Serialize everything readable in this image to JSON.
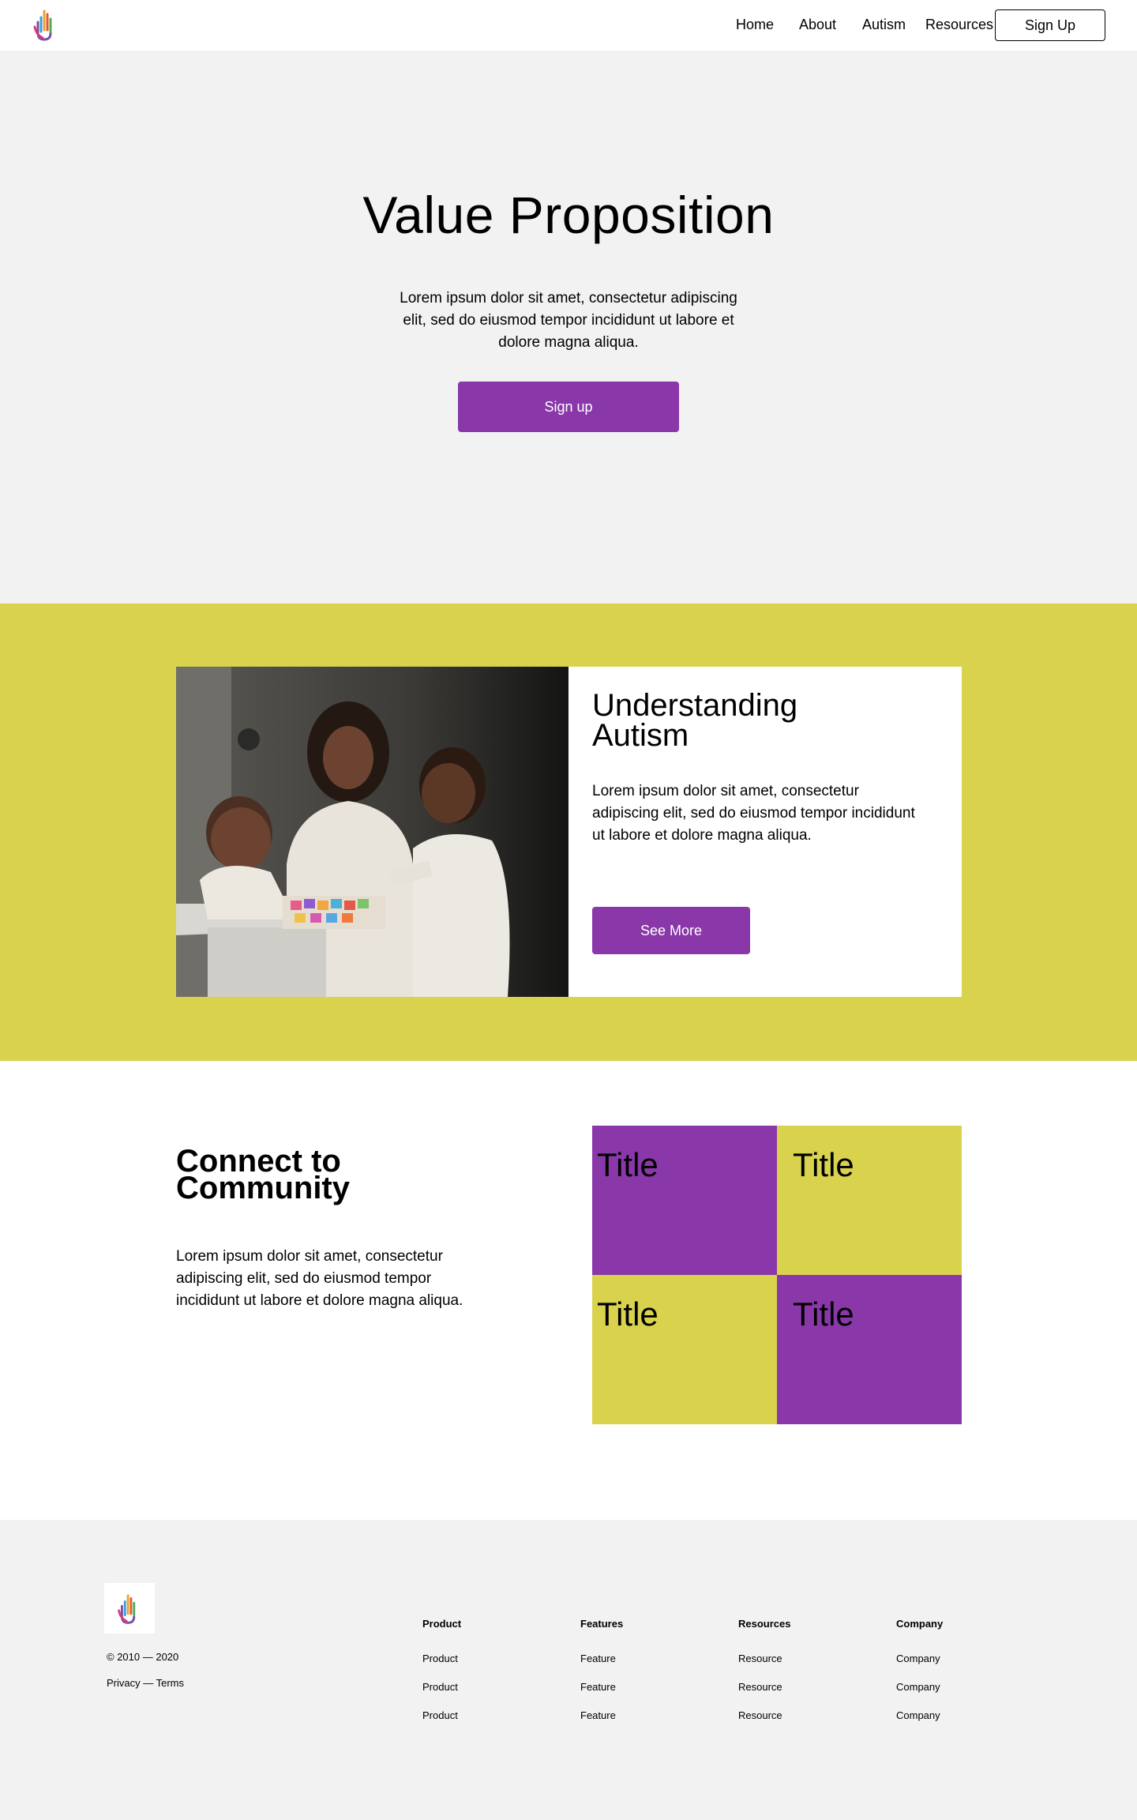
{
  "nav": {
    "links": [
      "Home",
      "About",
      "Autism",
      "Resources"
    ],
    "signup_label": "Sign Up"
  },
  "hero": {
    "title": "Value Proposition",
    "text": "Lorem ipsum dolor sit amet, consectetur adipiscing elit, sed do eiusmod tempor incididunt ut labore et dolore magna aliqua.",
    "button_label": "Sign up"
  },
  "understanding": {
    "title": "Understanding Autism",
    "text": "Lorem ipsum dolor sit amet, consectetur adipiscing elit, sed do eiusmod tempor incididunt ut labore et dolore magna aliqua.",
    "button_label": "See More"
  },
  "community": {
    "title": "Connect to Community",
    "text": "Lorem ipsum dolor sit amet, consectetur adipiscing elit, sed do eiusmod tempor incididunt ut labore et dolore magna aliqua.",
    "tiles": [
      "Title",
      "Title",
      "Title",
      "Title"
    ]
  },
  "footer": {
    "copyright": "© 2010 — 2020",
    "legal": "Privacy — Terms",
    "columns": [
      {
        "heading": "Product",
        "items": [
          "Product",
          "Product",
          "Product"
        ]
      },
      {
        "heading": "Features",
        "items": [
          "Feature",
          "Feature",
          "Feature"
        ]
      },
      {
        "heading": "Resources",
        "items": [
          "Resource",
          "Resource",
          "Resource"
        ]
      },
      {
        "heading": "Company",
        "items": [
          "Company",
          "Company",
          "Company"
        ]
      }
    ]
  },
  "colors": {
    "accent_purple": "#8a38a9",
    "accent_yellow": "#d8d24c",
    "light_gray": "#f2f2f2"
  },
  "icons": [
    "hand-logo-icon"
  ]
}
